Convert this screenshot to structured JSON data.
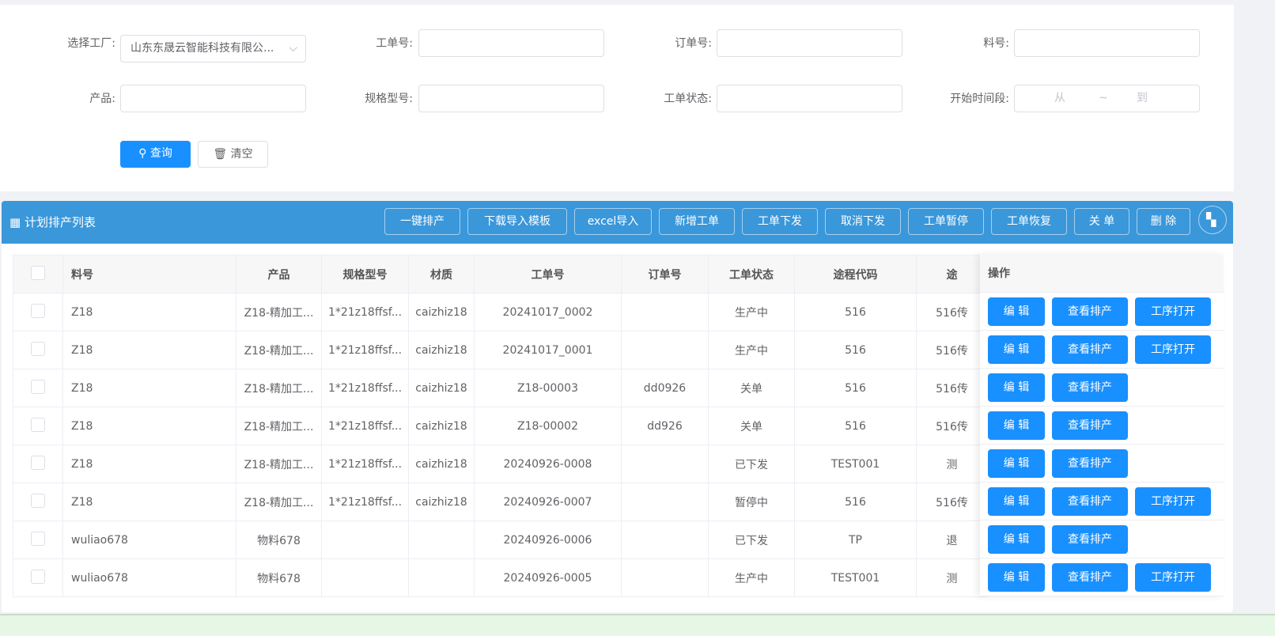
{
  "search": {
    "factory_label": "选择工厂:",
    "factory_value": "山东东晟云智能科技有限公...",
    "workorder_label": "工单号:",
    "order_label": "订单号:",
    "material_label": "料号:",
    "product_label": "产品:",
    "spec_label": "规格型号:",
    "status_label": "工单状态:",
    "time_label": "开始时间段:",
    "time_from": "从",
    "time_sep": "~",
    "time_to": "到",
    "query_button": "查询",
    "clear_button": "清空"
  },
  "panel": {
    "title": "计划排产列表",
    "toolbar": [
      "一键排产",
      "下载导入模板",
      "excel导入",
      "新增工单",
      "工单下发",
      "取消下发",
      "工单暂停",
      "工单恢复",
      "关 单",
      "删 除"
    ]
  },
  "table": {
    "columns": [
      "料号",
      "产品",
      "规格型号",
      "材质",
      "工单号",
      "订单号",
      "工单状态",
      "途程代码",
      "途"
    ],
    "op_header": "操作",
    "op_labels": {
      "edit": "编 辑",
      "view": "查看排产",
      "open": "工序打开"
    },
    "rows": [
      [
        "Z18",
        "Z18-精加工...",
        "1*21z18ffsf...",
        "caizhiz18",
        "20241017_0002",
        "",
        "生产中",
        "516",
        "516传"
      ],
      [
        "Z18",
        "Z18-精加工...",
        "1*21z18ffsf...",
        "caizhiz18",
        "20241017_0001",
        "",
        "生产中",
        "516",
        "516传"
      ],
      [
        "Z18",
        "Z18-精加工...",
        "1*21z18ffsf...",
        "caizhiz18",
        "Z18-00003",
        "dd0926",
        "关单",
        "516",
        "516传"
      ],
      [
        "Z18",
        "Z18-精加工...",
        "1*21z18ffsf...",
        "caizhiz18",
        "Z18-00002",
        "dd926",
        "关单",
        "516",
        "516传"
      ],
      [
        "Z18",
        "Z18-精加工...",
        "1*21z18ffsf...",
        "caizhiz18",
        "20240926-0008",
        "",
        "已下发",
        "TEST001",
        "测"
      ],
      [
        "Z18",
        "Z18-精加工...",
        "1*21z18ffsf...",
        "caizhiz18",
        "20240926-0007",
        "",
        "暂停中",
        "516",
        "516传"
      ],
      [
        "wuliao678",
        "物料678",
        "",
        "",
        "20240926-0006",
        "",
        "已下发",
        "TP",
        "退"
      ],
      [
        "wuliao678",
        "物料678",
        "",
        "",
        "20240926-0005",
        "",
        "生产中",
        "TEST001",
        "测"
      ]
    ],
    "row_has_open": [
      true,
      true,
      false,
      false,
      false,
      true,
      false,
      true
    ]
  },
  "colors": {
    "primary": "#1890ff",
    "header": "#3a97da"
  }
}
